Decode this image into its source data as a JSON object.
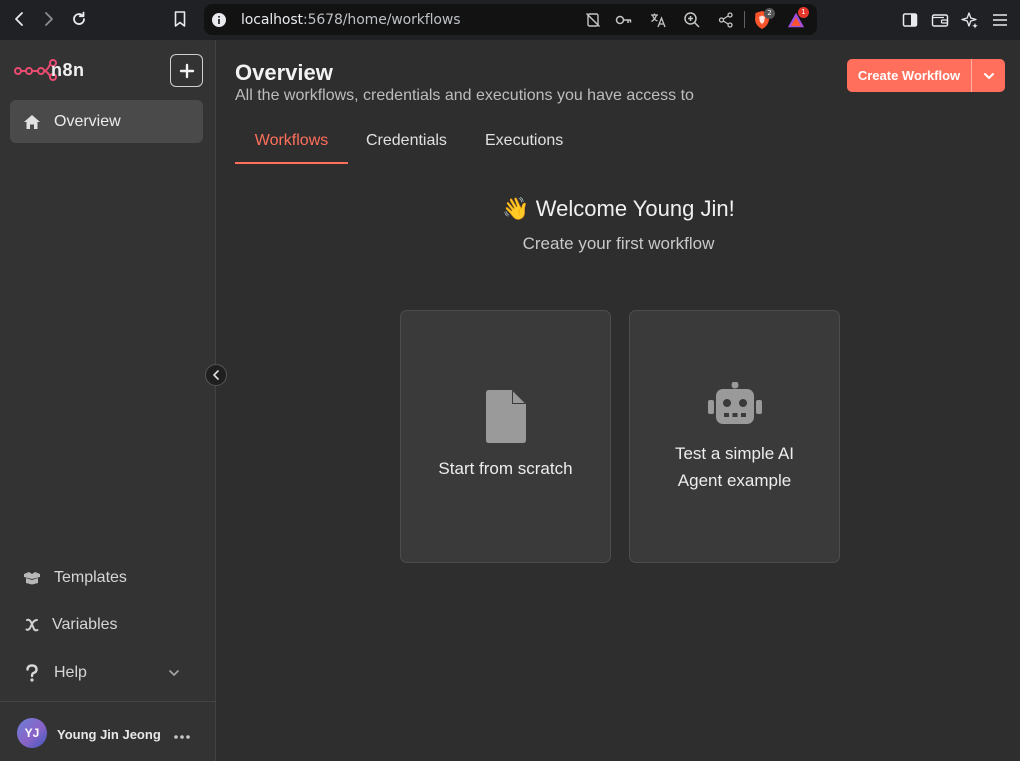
{
  "browser": {
    "url_host": "localhost",
    "url_path": ":5678/home/workflows",
    "brave_badge": "2",
    "alert_badge": "1"
  },
  "sidebar": {
    "logo_text": "n8n",
    "add_label": "+",
    "nav_items": [
      {
        "label": "Overview",
        "icon": "home-icon",
        "active": true
      }
    ],
    "bottom_items": [
      {
        "label": "Templates",
        "icon": "templates-icon"
      },
      {
        "label": "Variables",
        "icon": "variables-icon"
      },
      {
        "label": "Help",
        "icon": "help-icon"
      }
    ],
    "user": {
      "initials": "YJ",
      "name": "Young Jin Jeong"
    }
  },
  "main": {
    "title": "Overview",
    "subtitle": "All the workflows, credentials and executions you have access to",
    "create_button": "Create Workflow",
    "tabs": [
      {
        "label": "Workflows",
        "active": true
      },
      {
        "label": "Credentials",
        "active": false
      },
      {
        "label": "Executions",
        "active": false
      }
    ],
    "welcome": "👋 Welcome Young Jin!",
    "welcome_sub": "Create your first workflow",
    "cards": [
      {
        "label": "Start from scratch",
        "icon": "file-icon"
      },
      {
        "label_line1": "Test a simple AI",
        "label_line2": "Agent example",
        "icon": "robot-icon"
      }
    ]
  },
  "colors": {
    "accent": "#ff6f5c",
    "sidebar_bg": "#333333",
    "main_bg": "#2e2e2e",
    "card_bg": "#3a3a3a"
  }
}
